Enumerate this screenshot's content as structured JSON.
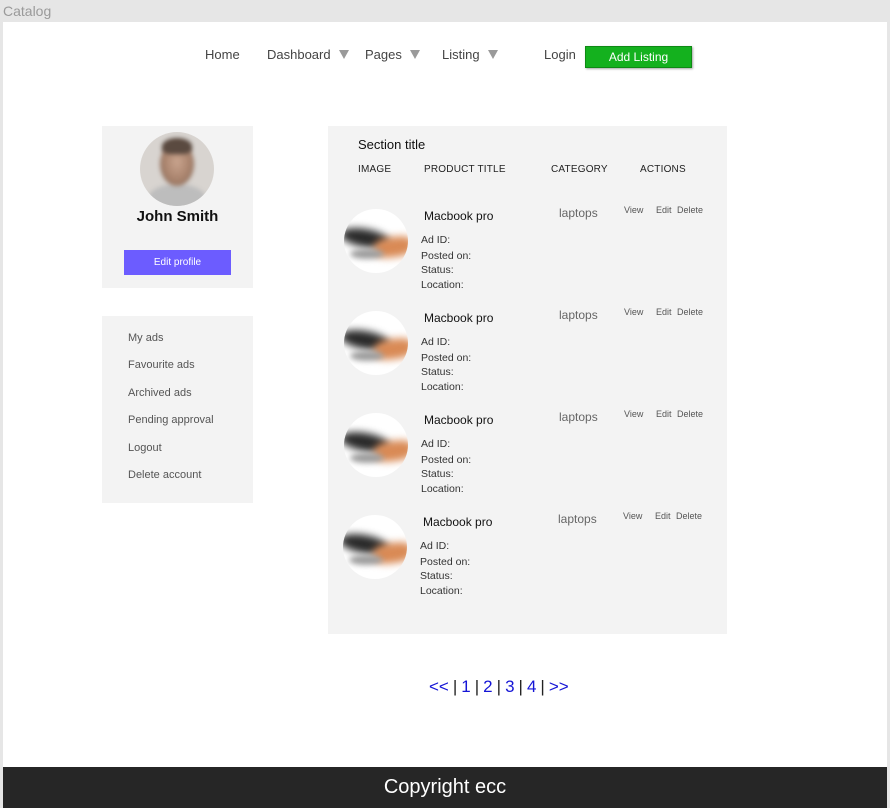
{
  "window": {
    "title": "Catalog"
  },
  "nav": {
    "home": "Home",
    "dashboard": "Dashboard",
    "pages": "Pages",
    "listing": "Listing",
    "login": "Login",
    "add_listing": "Add Listing"
  },
  "profile": {
    "name": "John Smith",
    "edit_label": "Edit profile"
  },
  "side_menu": {
    "items": [
      "My ads",
      "Favourite ads",
      "Archived ads",
      "Pending approval",
      "Logout",
      "Delete account"
    ]
  },
  "panel": {
    "section_title": "Section title",
    "columns": [
      "IMAGE",
      "PRODUCT TITLE",
      "CATEGORY",
      "ACTIONS"
    ],
    "rows": [
      {
        "title": "Macbook pro",
        "category": "laptops",
        "ad_id": "Ad ID:",
        "posted_on": "Posted on:",
        "status": "Status:",
        "location": "Location:",
        "view": "View",
        "edit": "Edit",
        "delete": "Delete"
      },
      {
        "title": "Macbook pro",
        "category": "laptops",
        "ad_id": "Ad ID:",
        "posted_on": "Posted on:",
        "status": "Status:",
        "location": "Location:",
        "view": "View",
        "edit": "Edit",
        "delete": "Delete"
      },
      {
        "title": "Macbook pro",
        "category": "laptops",
        "ad_id": "Ad ID:",
        "posted_on": "Posted on:",
        "status": "Status:",
        "location": "Location:",
        "view": "View",
        "edit": "Edit",
        "delete": "Delete"
      },
      {
        "title": "Macbook pro",
        "category": "laptops",
        "ad_id": "Ad ID:",
        "posted_on": "Posted on:",
        "status": "Status:",
        "location": "Location:",
        "view": "View",
        "edit": "Edit",
        "delete": "Delete"
      }
    ]
  },
  "pagination": {
    "prev": "<<",
    "pages": [
      "1",
      "2",
      "3",
      "4"
    ],
    "next": ">>",
    "separator": "|"
  },
  "footer": {
    "text": "Copyright ecc"
  },
  "colors": {
    "add_listing": "#14b11e",
    "edit_profile": "#6c5cff",
    "pagination_link": "#1515d6",
    "footer_bg": "#262626"
  }
}
